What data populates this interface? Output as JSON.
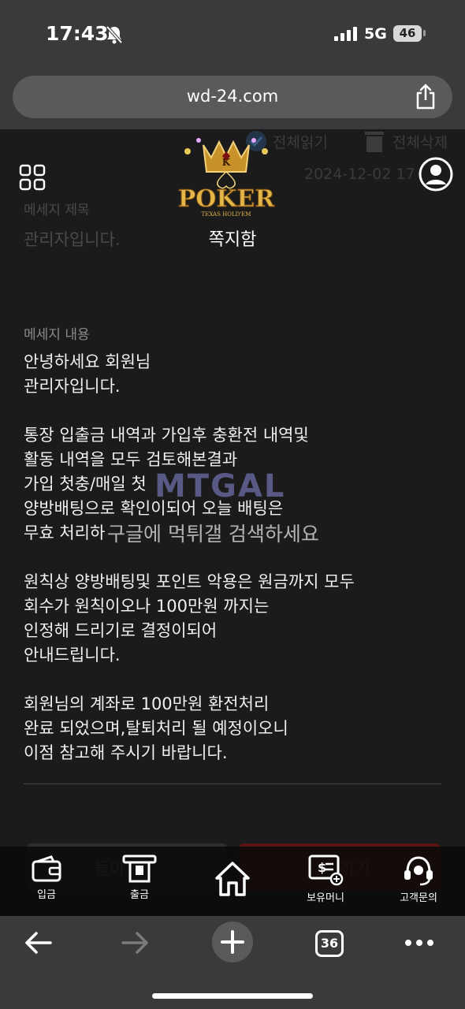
{
  "status": {
    "time": "17:43",
    "network": "5G",
    "battery": "46"
  },
  "browser": {
    "url": "wd-24.com",
    "tabs_count": "36"
  },
  "header": {
    "read_all": "전체읽기",
    "delete_all": "전체삭제",
    "date": "2024-12-02 17",
    "page_title": "쪽지함",
    "logo_text": "POKER",
    "logo_sub": "TEXAS HOLD'EM"
  },
  "message": {
    "subject_label": "메세지 제목",
    "subject": "관리자입니다.",
    "content_label": "메세지 내용",
    "lines": [
      "안녕하세요 회원님",
      "관리자입니다.",
      "",
      "통장 입출금 내역과 가입후 충환전 내역및",
      "활동 내역을 모두 검토해본결과",
      "가입 첫충/매일 첫",
      "양방배팅으로 확인이되어 오늘 배팅은",
      "무효 처리하",
      "",
      "원칙상 양방배팅및 포인트 악용은 원금까지 모두",
      "회수가 원칙이오나 100만원 까지는",
      "인정해 드리기로 결정이되어",
      "안내드립니다.",
      "",
      "회원님의 계좌로 100만원 환전처리",
      "완료 되었으며,탈퇴처리 될 예정이오니",
      "이점 참고해 주시기 바랍니다."
    ]
  },
  "buttons": {
    "back": "돌아",
    "right": "하기"
  },
  "watermark": {
    "brand": "MTGAL",
    "caption": "구글에 먹튀갤 검색하세요"
  },
  "bottom_nav": [
    {
      "label": "입금"
    },
    {
      "label": "출금"
    },
    {
      "label": ""
    },
    {
      "label": "보유머니"
    },
    {
      "label": "고객문의"
    }
  ]
}
